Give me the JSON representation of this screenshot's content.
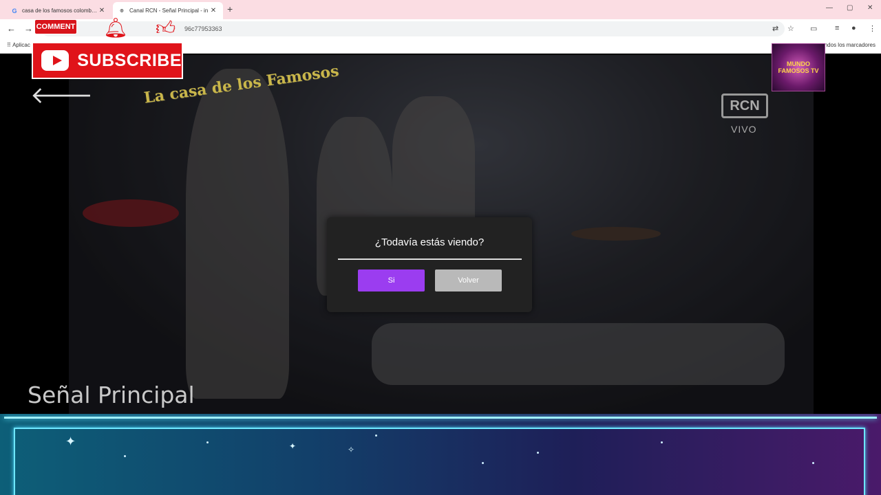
{
  "browser": {
    "tabs": [
      {
        "title": "casa de los famosos colombia -",
        "favicon": "G",
        "active": false
      },
      {
        "title": "Canal RCN - Señal Principal - in",
        "favicon": "RCN",
        "active": true
      }
    ],
    "new_tab": "+",
    "window_controls": {
      "minimize": "—",
      "maximize": "▢",
      "close": "✕"
    },
    "url": "96c77953363",
    "bookmarks": {
      "apps": "Aplicac",
      "other": "ndos los marcadores"
    }
  },
  "stickers": {
    "comment_label": "COMMENT",
    "subscribe_label": "SUBSCRIBE",
    "channel_logo_text": "MUNDO FAMOSOS TV"
  },
  "player": {
    "show_logo": "La casa de los Famosos",
    "channel_badge": "RCN",
    "live_label": "VIVO",
    "channel_title": "Señal Principal"
  },
  "modal": {
    "question": "¿Todavía estás viendo?",
    "yes_label": "Si",
    "back_label": "Volver"
  },
  "colors": {
    "accent_purple": "#9b3df0",
    "button_gray": "#b9b9b9",
    "sticker_red": "#e0141a",
    "tabbar_pink": "#fbdde3"
  }
}
